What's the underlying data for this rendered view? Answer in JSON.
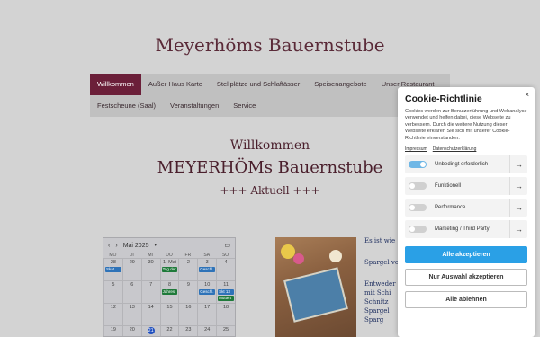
{
  "site": {
    "title": "Meyerhöms Bauernstube"
  },
  "nav": {
    "row1": [
      {
        "label": "Willkommen",
        "active": true
      },
      {
        "label": "Außer Haus Karte"
      },
      {
        "label": "Stellplätze und Schlaffässer"
      },
      {
        "label": "Speisenangebote"
      },
      {
        "label": "Unser Restaurant"
      }
    ],
    "row2": [
      {
        "label": "Festscheune (Saal)"
      },
      {
        "label": "Veranstaltungen"
      },
      {
        "label": "Service"
      }
    ]
  },
  "main": {
    "heading1": "Willkommen",
    "heading2": "MEYERHÖMs Bauernstube",
    "heading3": "+++ Aktuell +++",
    "side_lines": [
      "Es ist wie",
      "Spargel vo",
      "Entweder",
      "mit Schi",
      "Schnitz",
      "Spargel",
      "Sparg"
    ]
  },
  "calendar": {
    "prev_icon": "chevron-left",
    "next_icon": "chevron-right",
    "month_label": "Mai 2025",
    "dow": [
      "MO",
      "DI",
      "MI",
      "DO",
      "FR",
      "SA",
      "SO"
    ],
    "days": [
      {
        "d": "28",
        "ev": [
          "Skat"
        ]
      },
      {
        "d": "29"
      },
      {
        "d": "30"
      },
      {
        "d": "1. Mai",
        "ev": [
          "Tag der"
        ]
      },
      {
        "d": "2"
      },
      {
        "d": "3",
        "ev": [
          "Geschl."
        ]
      },
      {
        "d": "4"
      },
      {
        "d": "5"
      },
      {
        "d": "6"
      },
      {
        "d": "7"
      },
      {
        "d": "8",
        "ev": [
          "Jahres"
        ]
      },
      {
        "d": "9"
      },
      {
        "d": "10",
        "ev": [
          "Geschl."
        ]
      },
      {
        "d": "11",
        "ev": [
          "Skt 13",
          "Muttert"
        ]
      },
      {
        "d": "12"
      },
      {
        "d": "13"
      },
      {
        "d": "14"
      },
      {
        "d": "15"
      },
      {
        "d": "16"
      },
      {
        "d": "17"
      },
      {
        "d": "18"
      },
      {
        "d": "19"
      },
      {
        "d": "20"
      },
      {
        "d": "21",
        "today": true
      },
      {
        "d": "22"
      },
      {
        "d": "23"
      },
      {
        "d": "24"
      },
      {
        "d": "25"
      }
    ]
  },
  "cookie": {
    "title": "Cookie-Richtlinie",
    "close_label": "×",
    "text": "Cookies werden zur Benutzerführung und Webanalyse verwendet und helfen dabei, diese Webseite zu verbessern. Durch die weitere Nutzung dieser Webseite erklären Sie sich mit unserer Cookie-Richtlinie einverstanden.",
    "link_impressum": "Impressum",
    "link_datenschutz": "Datenschutzerklärung",
    "options": [
      {
        "label": "Unbedingt erforderlich",
        "on": true
      },
      {
        "label": "Funktionell",
        "on": false
      },
      {
        "label": "Performance",
        "on": false
      },
      {
        "label": "Marketing / Third Party",
        "on": false
      }
    ],
    "btn_accept_all": "Alle akzeptieren",
    "btn_accept_selection": "Nur Auswahl akzeptieren",
    "btn_reject_all": "Alle ablehnen"
  }
}
